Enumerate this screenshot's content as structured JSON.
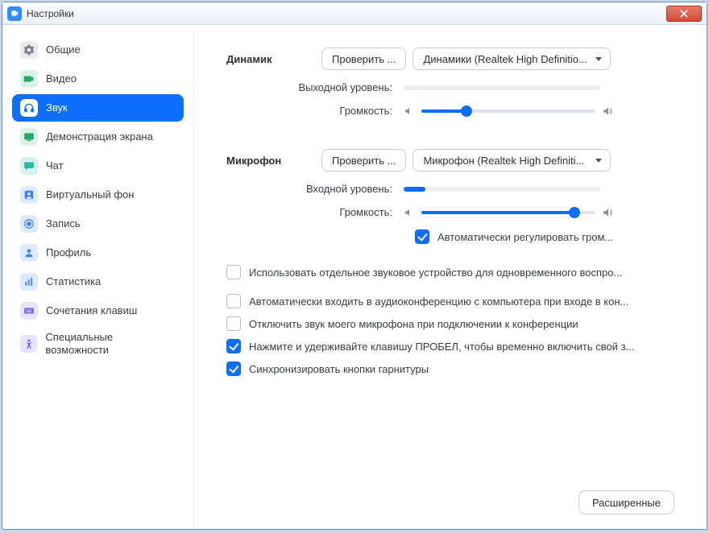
{
  "window": {
    "title": "Настройки"
  },
  "sidebar": {
    "items": [
      {
        "label": "Общие"
      },
      {
        "label": "Видео"
      },
      {
        "label": "Звук"
      },
      {
        "label": "Демонстрация экрана"
      },
      {
        "label": "Чат"
      },
      {
        "label": "Виртуальный фон"
      },
      {
        "label": "Запись"
      },
      {
        "label": "Профиль"
      },
      {
        "label": "Статистика"
      },
      {
        "label": "Сочетания клавиш"
      },
      {
        "label": "Специальные возможности"
      }
    ]
  },
  "speaker": {
    "label": "Динамик",
    "test_btn": "Проверить ...",
    "device": "Динамики (Realtek High Definitio...",
    "output_level_label": "Выходной уровень:",
    "volume_label": "Громкость:",
    "volume_pct": 26
  },
  "mic": {
    "label": "Микрофон",
    "test_btn": "Проверить ...",
    "device": "Микрофон (Realtek High Definiti...",
    "input_level_label": "Входной уровень:",
    "input_level_pct": 11,
    "volume_label": "Громкость:",
    "volume_pct": 88,
    "auto_adjust": {
      "checked": true,
      "label": "Автоматически регулировать гром..."
    }
  },
  "options": {
    "separate_device": {
      "checked": false,
      "label": "Использовать отдельное звуковое устройство для одновременного воспро..."
    },
    "auto_join_audio": {
      "checked": false,
      "label": "Автоматически входить в аудиоконференцию с компьютера при входе в кон..."
    },
    "mute_on_join": {
      "checked": false,
      "label": "Отключить звук моего микрофона при подключении к конференции"
    },
    "space_unmute": {
      "checked": true,
      "label": "Нажмите и удерживайте клавишу ПРОБЕЛ, чтобы временно включить свой з..."
    },
    "sync_headset": {
      "checked": true,
      "label": "Синхронизировать кнопки гарнитуры"
    }
  },
  "advanced_btn": "Расширенные"
}
